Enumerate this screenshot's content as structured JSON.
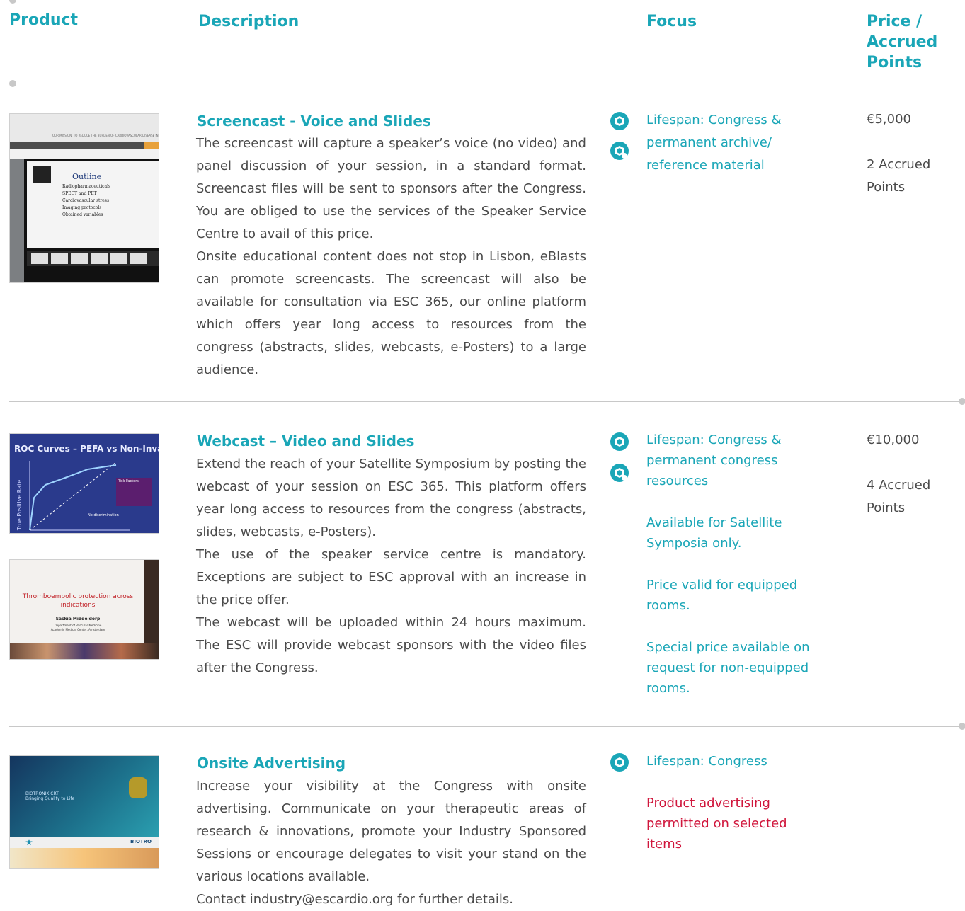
{
  "header": {
    "product": "Product",
    "description": "Description",
    "focus": "Focus",
    "price": [
      "Price /",
      "Accrued",
      "Points"
    ]
  },
  "rows": [
    {
      "title": "Screencast - Voice and Slides",
      "paragraphs": [
        "The screencast will capture a speaker’s voice (no video) and panel discussion of your session, in a standard format. Screencast files will be sent to sponsors after the Congress. You are obliged to use the services of the Speaker Service Centre to avail of this price.",
        "Onsite educational content does not stop in Lisbon, eBlasts can promote screencasts. The screencast will also be available for consultation via ESC 365, our online platform which offers year long access to resources from the congress (abstracts, slides, webcasts, e-Posters) to a large audience."
      ],
      "focus": "Lifespan: Congress & permanent archive/ reference material",
      "price": "€5,000",
      "points": [
        "2 Accrued",
        "Points"
      ],
      "thumb": {
        "header_text": "OUR MISSION: TO REDUCE THE BURDEN OF CARDIOVASCULAR DISEASE IN EUROPE",
        "slide_title": "Outline",
        "bullets": [
          "Radiopharmaceuticals",
          "SPECT and PET",
          "Cardiovascular stress",
          "Imaging protocols",
          "Obtained variables"
        ]
      }
    },
    {
      "title": "Webcast – Video and Slides",
      "paragraphs": [
        "Extend the reach of your Satellite Symposium by posting the webcast of your session on ESC 365. This platform offers year long access to resources from the congress (abstracts, slides, webcasts, e-Posters).",
        "The use of the speaker service centre is mandatory. Exceptions are subject to ESC approval with an increase in the price offer.",
        "The webcast will be uploaded within 24 hours maximum. The ESC will provide webcast sponsors with the video files after the Congress."
      ],
      "focus": "Lifespan: Congress & permanent congress resources",
      "notes": [
        "Available for Satellite Symposia only.",
        "Price valid for equipped rooms.",
        "Special price available on request for non-equipped rooms."
      ],
      "price": "€10,000",
      "points": [
        "4 Accrued",
        "Points"
      ],
      "thumb1": {
        "slide_title": "ROC Curves – PEFA vs Non-Invasive",
        "ylabel": "True Positive Rate",
        "legend": "Risk Factors",
        "annotation": "No discrimination"
      },
      "thumb2": {
        "slide_title": "Thromboembolic protection across indications",
        "speaker": "Saskia Middeldorp",
        "affil1": "Department of Vascular Medicine",
        "affil2": "Academic Medical Center, Amsterdam"
      }
    },
    {
      "title": "Onsite Advertising",
      "paragraphs": [
        "Increase your visibility at the Congress with onsite advertising. Communicate on your therapeutic areas of research & innovations, promote your Industry Sponsored Sessions or encourage delegates to visit your stand on the various locations available.",
        "Contact industry@escardio.org for further details."
      ],
      "focus": "Lifespan: Congress",
      "notes": [
        "Product advertising permitted on selected items"
      ],
      "thumb": {
        "banner_line1": "BIOTRONIK CRT",
        "banner_line2": "Bringing Quality to Life",
        "brand": "BIOTRO"
      }
    }
  ],
  "colors": {
    "accent": "#1aa6b7",
    "red": "#d0163c",
    "text": "#4a4a4a",
    "rule": "#c8c8c8"
  },
  "icons": [
    "hexagon-icon",
    "location-hexagon-icon"
  ]
}
